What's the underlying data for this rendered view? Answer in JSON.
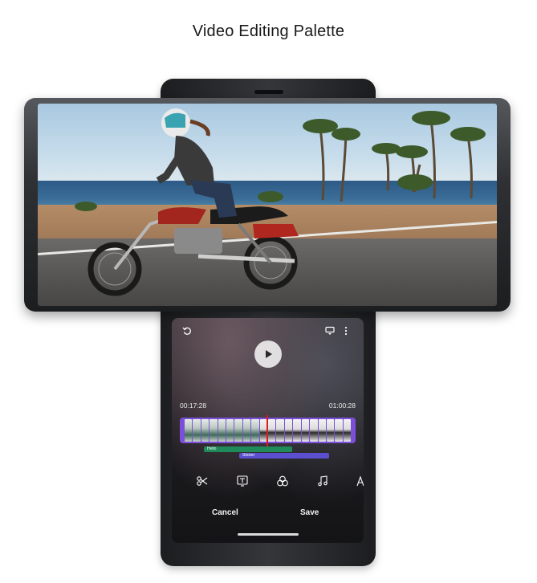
{
  "page": {
    "title": "Video Editing Palette"
  },
  "player": {
    "current_time": "00:17:28",
    "total_time": "01:00:28"
  },
  "tracks": [
    {
      "label": "Hello",
      "color": "#1f8a5a"
    },
    {
      "label": "Sticker",
      "color": "#5b4fcf"
    }
  ],
  "icons": {
    "top_left": "undo-icon",
    "top_right_1": "export-icon",
    "top_right_2": "more-vert-icon",
    "play": "play-icon",
    "tools": [
      "scissors-icon",
      "text-icon",
      "filter-icon",
      "music-icon",
      "more-tools-icon"
    ]
  },
  "actions": {
    "cancel_label": "Cancel",
    "save_label": "Save"
  },
  "colors": {
    "timeline": "#7b4fd9",
    "playhead": "#e0191f"
  }
}
